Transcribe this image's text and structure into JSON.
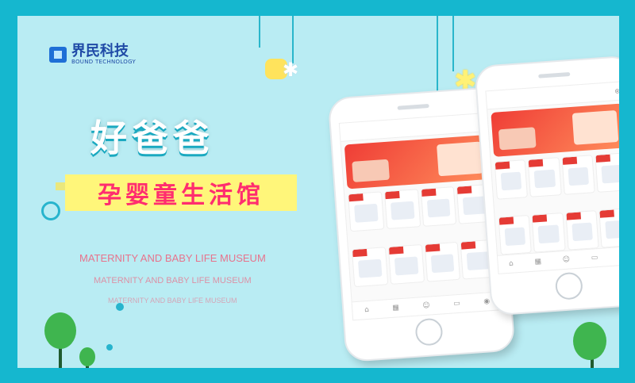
{
  "brand": {
    "name_cn": "界民科技",
    "name_en": "BOUND TECHNOLOGY"
  },
  "hero": {
    "title": "好爸爸",
    "subtitle": "孕婴童生活馆",
    "eng_lines": [
      "MATERNITY AND BABY LIFE MUSEUM",
      "MATERNITY AND BABY LIFE MUSEUM",
      "MATERNITY AND BABY LIFE MUSEUM"
    ]
  },
  "colors": {
    "border": "#15b7cf",
    "background": "#b9ecf3",
    "title": "#ffffff",
    "subtitle": "#ff2d6f",
    "subtitle_bg": "#fff67a",
    "accent_red": "#e53b35"
  }
}
